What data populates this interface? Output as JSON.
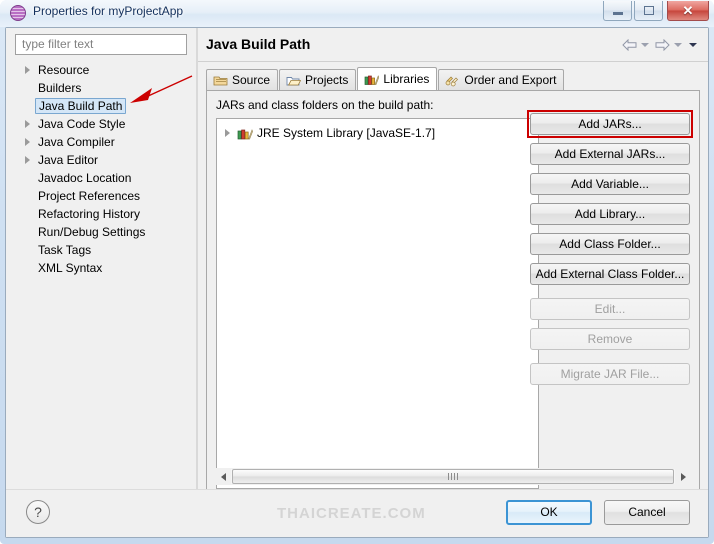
{
  "window": {
    "title": "Properties for myProjectApp",
    "icon": "eclipse-sphere-icon",
    "controls": {
      "minimize": "minimize-icon",
      "maximize": "maximize-icon",
      "close": "close-icon"
    }
  },
  "sidebar": {
    "filter": {
      "placeholder": "type filter text",
      "value": ""
    },
    "items": [
      {
        "label": "Resource",
        "expandable": true,
        "selected": false
      },
      {
        "label": "Builders",
        "expandable": false,
        "selected": false
      },
      {
        "label": "Java Build Path",
        "expandable": false,
        "selected": true
      },
      {
        "label": "Java Code Style",
        "expandable": true,
        "selected": false
      },
      {
        "label": "Java Compiler",
        "expandable": true,
        "selected": false
      },
      {
        "label": "Java Editor",
        "expandable": true,
        "selected": false
      },
      {
        "label": "Javadoc Location",
        "expandable": false,
        "selected": false
      },
      {
        "label": "Project References",
        "expandable": false,
        "selected": false
      },
      {
        "label": "Refactoring History",
        "expandable": false,
        "selected": false
      },
      {
        "label": "Run/Debug Settings",
        "expandable": false,
        "selected": false
      },
      {
        "label": "Task Tags",
        "expandable": false,
        "selected": false
      },
      {
        "label": "XML Syntax",
        "expandable": false,
        "selected": false
      }
    ]
  },
  "content": {
    "page_title": "Java Build Path",
    "nav": {
      "back": "back-arrow-icon",
      "forward": "forward-arrow-icon",
      "menu": "dropdown-caret-icon"
    },
    "tabs": [
      {
        "label": "Source",
        "icon": "source-folder-icon",
        "active": false
      },
      {
        "label": "Projects",
        "icon": "open-folder-icon",
        "active": false
      },
      {
        "label": "Libraries",
        "icon": "books-icon",
        "active": true
      },
      {
        "label": "Order and Export",
        "icon": "order-export-icon",
        "active": false
      }
    ],
    "list_label": "JARs and class folders on the build path:",
    "entries": [
      {
        "label": "JRE System Library [JavaSE-1.7]",
        "icon": "books-icon",
        "expandable": true
      }
    ],
    "buttons": [
      {
        "label": "Add JARs...",
        "enabled": true,
        "highlighted": true,
        "gap_above": false
      },
      {
        "label": "Add External JARs...",
        "enabled": true,
        "highlighted": false,
        "gap_above": false
      },
      {
        "label": "Add Variable...",
        "enabled": true,
        "highlighted": false,
        "gap_above": false
      },
      {
        "label": "Add Library...",
        "enabled": true,
        "highlighted": false,
        "gap_above": false
      },
      {
        "label": "Add Class Folder...",
        "enabled": true,
        "highlighted": false,
        "gap_above": false
      },
      {
        "label": "Add External Class Folder...",
        "enabled": true,
        "highlighted": false,
        "gap_above": false
      },
      {
        "label": "Edit...",
        "enabled": false,
        "highlighted": false,
        "gap_above": true
      },
      {
        "label": "Remove",
        "enabled": false,
        "highlighted": false,
        "gap_above": false
      },
      {
        "label": "Migrate JAR File...",
        "enabled": false,
        "highlighted": false,
        "gap_above": true
      }
    ],
    "scrollbar": {
      "left": "scroll-left-arrow-icon",
      "right": "scroll-right-arrow-icon"
    }
  },
  "footer": {
    "help": "?",
    "ok": "OK",
    "cancel": "Cancel"
  },
  "annotations": {
    "arrow_color": "#cc0000",
    "highlight_color": "#cc0000",
    "watermark": "THAICREATE.COM"
  }
}
